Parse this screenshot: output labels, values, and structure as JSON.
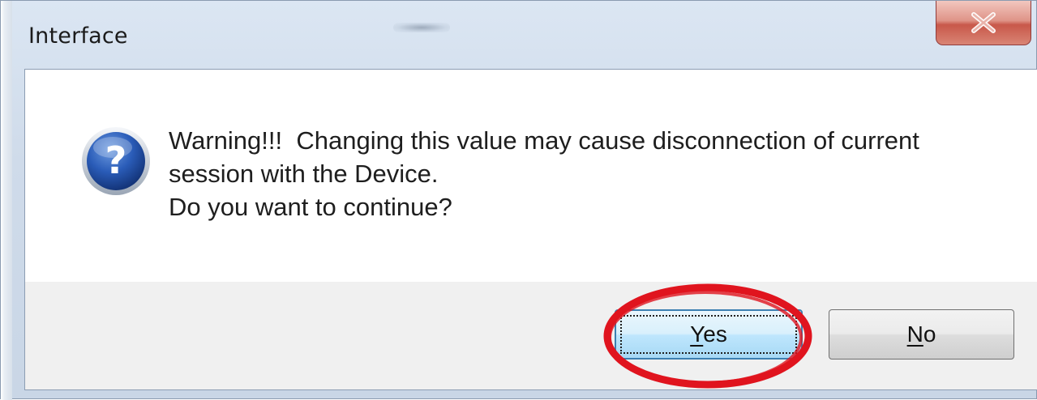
{
  "window": {
    "title": "Interface"
  },
  "message": {
    "lines": [
      "Warning!!!  Changing this value may cause disconnection of current",
      "session with the Device.",
      "Do you want to continue?"
    ],
    "icon": "question-icon"
  },
  "buttons": {
    "yes": {
      "mnemonic": "Y",
      "rest": "es"
    },
    "no": {
      "mnemonic": "N",
      "rest": "o"
    }
  },
  "colors": {
    "highlight": "#e0141e",
    "icon_blue": "#1f4fa8",
    "close_red": "#c8584a"
  }
}
